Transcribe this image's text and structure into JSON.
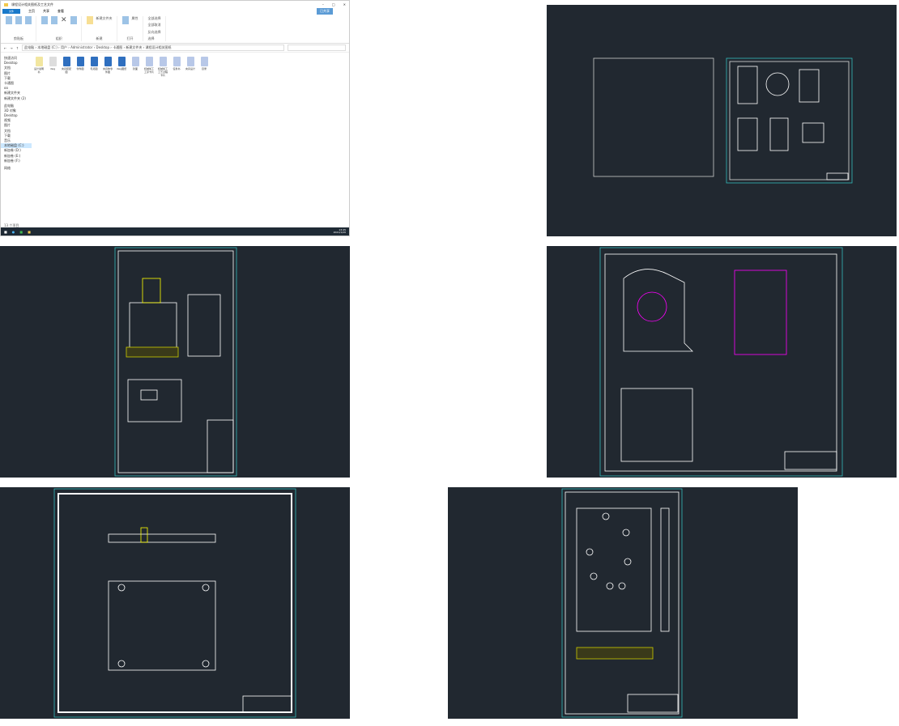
{
  "explorer": {
    "title": "课程设计相关图纸及工艺文件",
    "menu": [
      "文件",
      "主页",
      "共享",
      "查看"
    ],
    "share_button": "已共享",
    "ribbon_groups": [
      "剪贴板",
      "组织",
      "新建",
      "打开",
      "选择"
    ],
    "ribbon_buttons": [
      "固定到快速访问",
      "复制",
      "粘贴",
      "移动到",
      "复制到",
      "删除",
      "重命名",
      "新建文件夹",
      "属性",
      "全部选择",
      "全部取消",
      "反向选择"
    ],
    "path": [
      "此电脑",
      "本地磁盘 (C:)",
      "用户",
      "Administrator",
      "Desktop",
      "卡通图",
      "新建文件夹",
      "课程设计相关图纸"
    ],
    "nav": [
      "快速访问",
      "Desktop",
      "文档",
      "图片",
      "下载",
      "卡通图",
      "oo",
      "新建文件夹",
      "新建文件夹 (2)",
      "此电脑",
      "3D 对象",
      "Desktop",
      "视频",
      "图片",
      "文档",
      "下载",
      "音乐",
      "本地磁盘 (C:)",
      "新加卷 (D:)",
      "新加卷 (E:)",
      "新加卷 (F:)",
      "网络"
    ],
    "files": [
      {
        "name": "设计说明书",
        "type": "doc"
      },
      {
        "name": "dwg",
        "type": "folder"
      },
      {
        "name": "夹具装配图",
        "type": "cad"
      },
      {
        "name": "零件图",
        "type": "cad"
      },
      {
        "name": "毛坯图",
        "type": "cad"
      },
      {
        "name": "夹具体零件图",
        "type": "cad"
      },
      {
        "name": "dwg图纸",
        "type": "cad"
      },
      {
        "name": "封面",
        "type": "word"
      },
      {
        "name": "机械加工工序卡片",
        "type": "word"
      },
      {
        "name": "机械加工工艺过程卡片",
        "type": "word"
      },
      {
        "name": "任务书",
        "type": "word"
      },
      {
        "name": "夹具设计",
        "type": "word"
      },
      {
        "name": "目录",
        "type": "word"
      }
    ],
    "status": "13 个项目",
    "clock": {
      "time": "13:45",
      "date": "2021/1/20"
    }
  },
  "colors": {
    "cad_bg": "#212830",
    "accent": "#1979ca"
  }
}
